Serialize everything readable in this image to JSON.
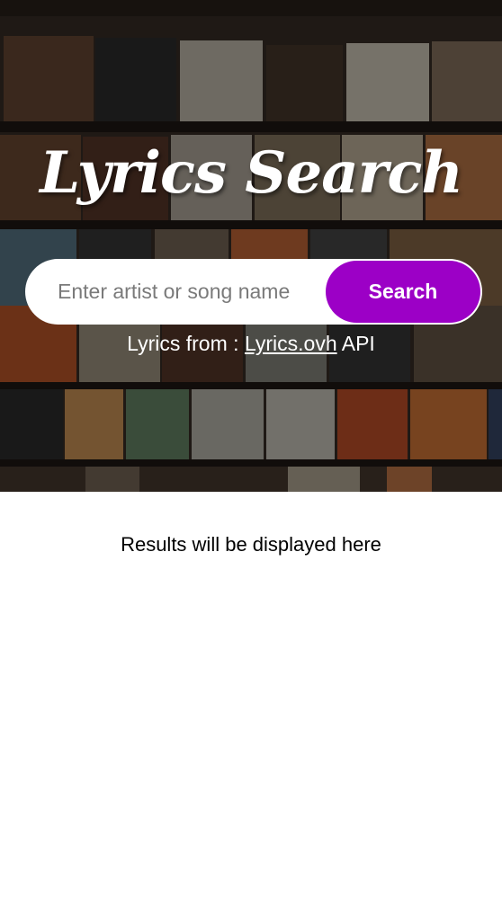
{
  "header": {
    "title": "Lyrics Search"
  },
  "search": {
    "placeholder": "Enter artist or song name",
    "value": "",
    "button_label": "Search"
  },
  "credit": {
    "prefix": "Lyrics from : ",
    "link_text": "Lyrics.ovh",
    "suffix": " API"
  },
  "results": {
    "placeholder": "Results will be displayed here"
  },
  "colors": {
    "accent": "#9c00c6",
    "background": "#ffffff"
  }
}
